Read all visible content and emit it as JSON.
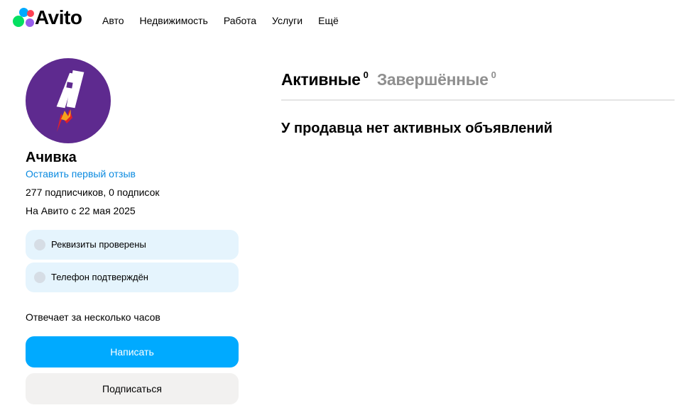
{
  "header": {
    "logo_text": "Avito",
    "nav": [
      {
        "label": "Авто"
      },
      {
        "label": "Недвижимость"
      },
      {
        "label": "Работа"
      },
      {
        "label": "Услуги"
      },
      {
        "label": "Ещё"
      }
    ]
  },
  "profile": {
    "avatar_icon": "rocket-letter-a",
    "name": "Ачивка",
    "review_link": "Оставить первый отзыв",
    "subscribers": "277 подписчиков, 0 подписок",
    "since": "На Авито с 22 мая 2025",
    "badges": [
      {
        "label": "Реквизиты проверены"
      },
      {
        "label": "Телефон подтверждён"
      }
    ],
    "reply_time": "Отвечает за несколько часов",
    "write_button": "Написать",
    "subscribe_button": "Подписаться"
  },
  "listings": {
    "tabs": [
      {
        "label": "Активные",
        "count": "0"
      },
      {
        "label": "Завершённые",
        "count": "0"
      }
    ],
    "empty_message": "У продавца нет активных объявлений"
  },
  "colors": {
    "accent": "#00aaff",
    "link": "#0a8ae0",
    "avatar_bg": "#5e2a8f",
    "badge_bg": "#e5f4fd"
  }
}
